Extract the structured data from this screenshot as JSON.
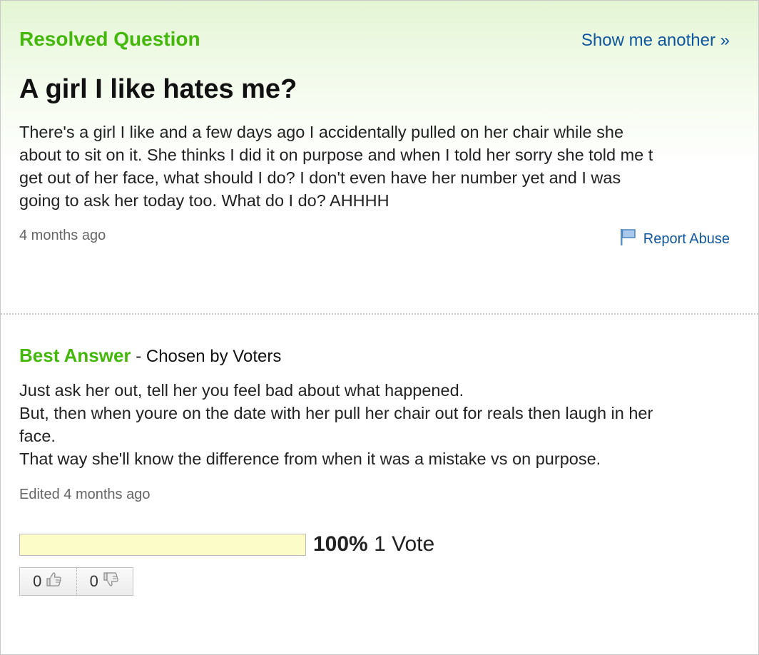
{
  "header": {
    "status_label": "Resolved Question",
    "show_another_label": "Show me another »"
  },
  "question": {
    "title": "A girl I like hates me?",
    "lines": [
      "There's a girl I like and a few days ago I accidentally pulled on her chair while she",
      "about to sit on it. She thinks I did it on purpose and when I told her sorry she told me t",
      "get out of her face, what should I do? I don't even have her number yet and I was",
      "going to ask her today too. What do I do? AHHHH"
    ],
    "time_ago": "4 months ago",
    "report_label": "Report Abuse"
  },
  "best_answer": {
    "label": "Best Answer",
    "separator": " - ",
    "chosen_by": "Chosen by Voters",
    "lines": [
      "Just ask her out, tell her you feel bad about what happened.",
      "But, then when youre on the date with her pull her chair out for reals then laugh in her",
      "face.",
      "That way she'll know the difference from when it was a mistake vs on purpose."
    ],
    "edited": "Edited 4 months ago",
    "vote_percent": "100%",
    "vote_percent_value": 100,
    "vote_count": "1 Vote",
    "thumbs_up_count": "0",
    "thumbs_down_count": "0"
  },
  "colors": {
    "accent_green": "#43b70a",
    "link_blue": "#10569e",
    "vote_bar": "#fbfbcf"
  },
  "icons": {
    "flag": "flag-icon",
    "thumbs_up": "thumbs-up-icon",
    "thumbs_down": "thumbs-down-icon"
  }
}
